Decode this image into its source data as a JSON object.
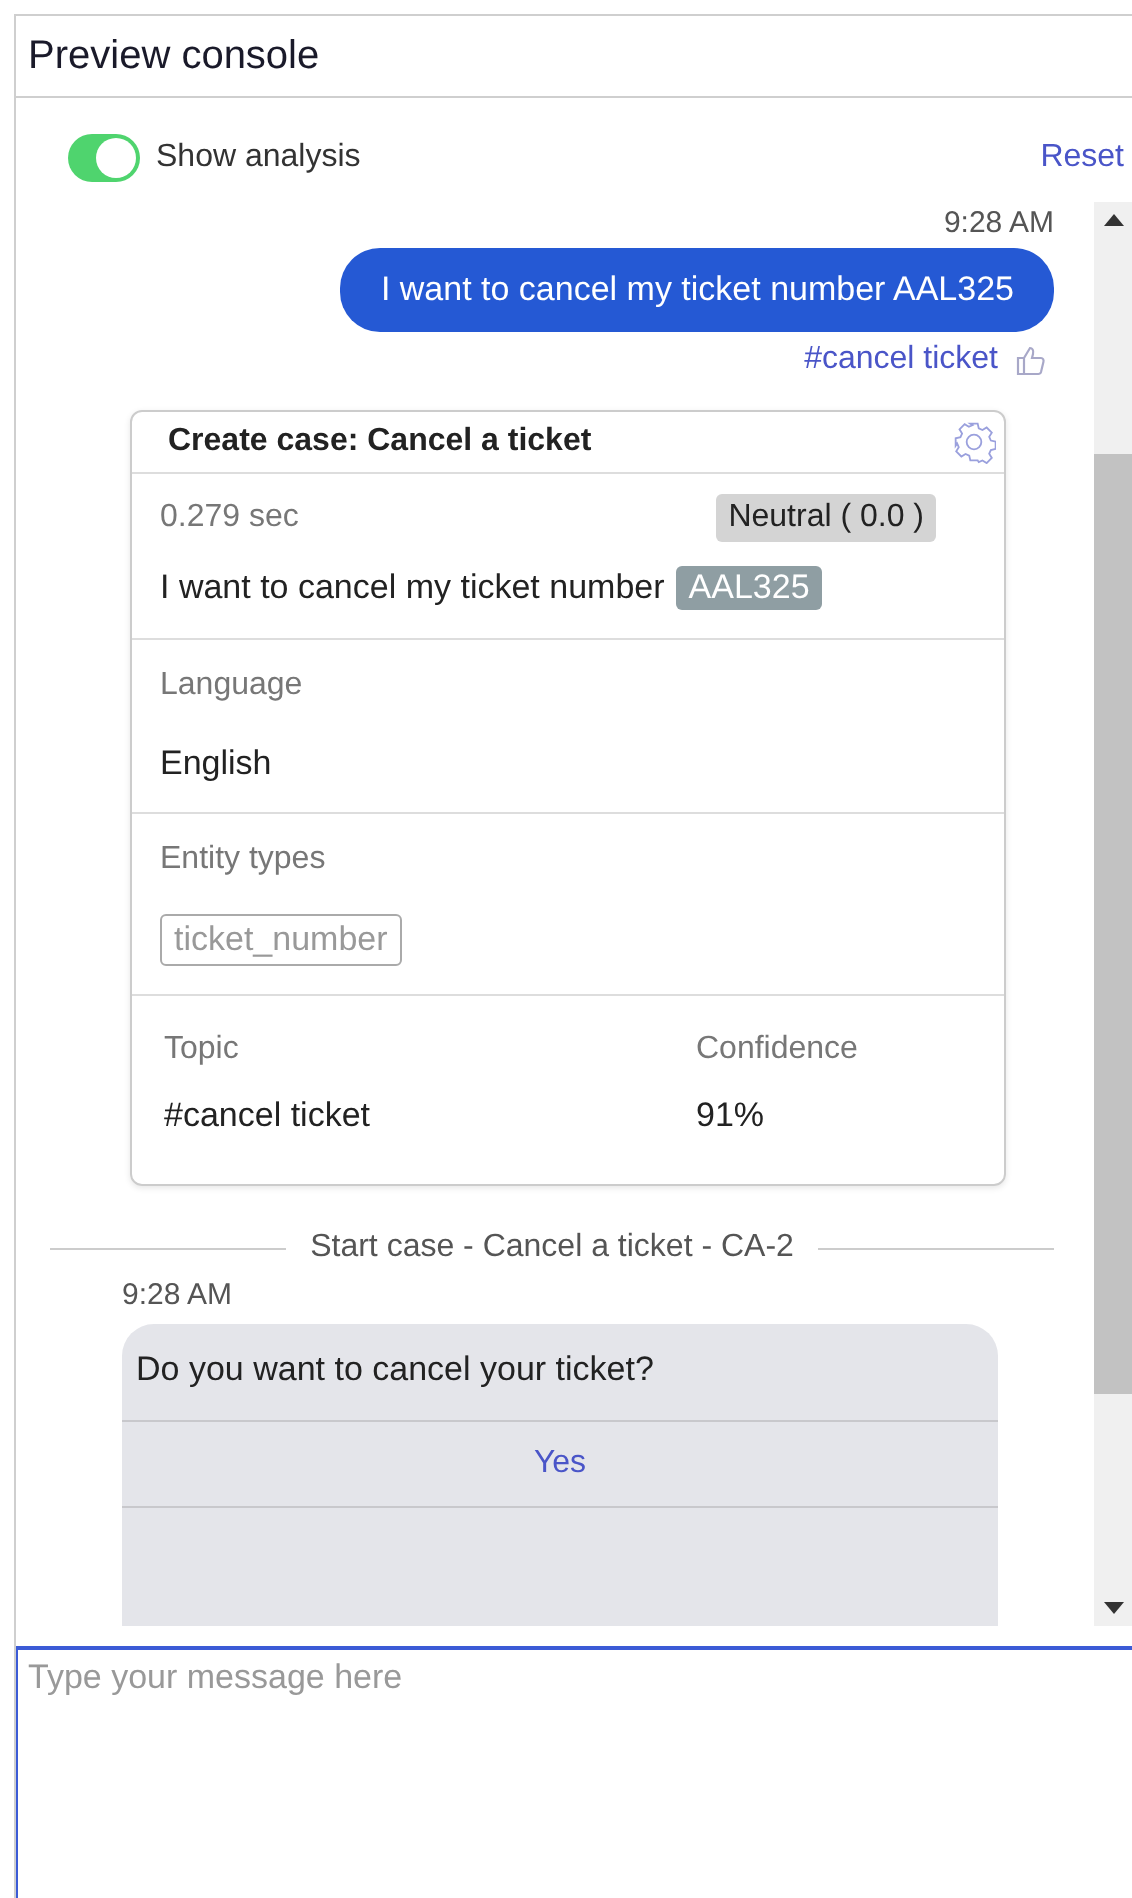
{
  "header": {
    "title": "Preview console"
  },
  "toolbar": {
    "toggle": {
      "label": "Show analysis",
      "on": true
    },
    "reset": "Reset"
  },
  "messages": [
    {
      "kind": "user",
      "time": "9:28 AM",
      "text": "I want to cancel my ticket number AAL325",
      "intent": "#cancel ticket"
    },
    {
      "kind": "analysis",
      "title": "Create case:  Cancel a ticket",
      "duration": "0.279 sec",
      "sentiment": "Neutral ( 0.0 )",
      "utterance": "I want to cancel my ticket number",
      "entity_value": "AAL325",
      "language_label": "Language",
      "language": "English",
      "entity_types_label": "Entity types",
      "entity_types": [
        "ticket_number"
      ],
      "topic_label": "Topic",
      "topic": "#cancel ticket",
      "confidence_label": "Confidence",
      "confidence": "91%"
    },
    {
      "kind": "divider",
      "text": "Start case - Cancel a ticket - CA-2"
    },
    {
      "kind": "bot",
      "time": "9:28 AM",
      "text": "Do you want to cancel your ticket?",
      "options": [
        "Yes"
      ]
    }
  ],
  "composer": {
    "placeholder": "Type your message here"
  }
}
